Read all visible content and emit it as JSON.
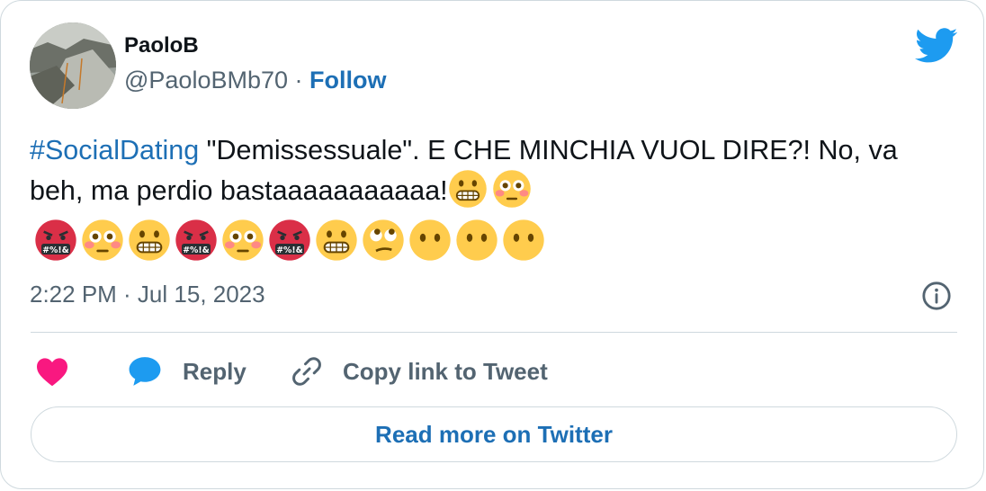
{
  "tweet": {
    "author_name": "PaoloB",
    "author_handle": "@PaoloBMb70",
    "separator": " · ",
    "follow_label": "Follow",
    "hashtag": "#SocialDating",
    "text_body": " \"Demissessuale\". E CHE MINCHIA VUOL DIRE?! No, va beh,  ma perdio bastaaaaaaaaaaa!",
    "inline_emojis": [
      "grimacing",
      "flushed"
    ],
    "emoji_row": [
      "cursing",
      "flushed",
      "grimacing",
      "cursing",
      "flushed",
      "cursing",
      "grimacing",
      "eye-roll",
      "no-mouth",
      "no-mouth",
      "no-mouth"
    ],
    "timestamp": "2:22 PM · Jul 15, 2023"
  },
  "actions": {
    "reply_label": "Reply",
    "copy_label": "Copy link to Tweet",
    "read_more_label": "Read more on Twitter"
  },
  "icons": {
    "like": "heart-icon",
    "reply": "speech-bubble-icon",
    "copy": "link-icon",
    "info": "info-icon",
    "brand": "twitter-bird-icon"
  },
  "colors": {
    "link": "#1d6fb5",
    "brand": "#1d9bf0",
    "secondary_text": "#536471",
    "heart": "#f91880",
    "border": "#cfd9de"
  }
}
